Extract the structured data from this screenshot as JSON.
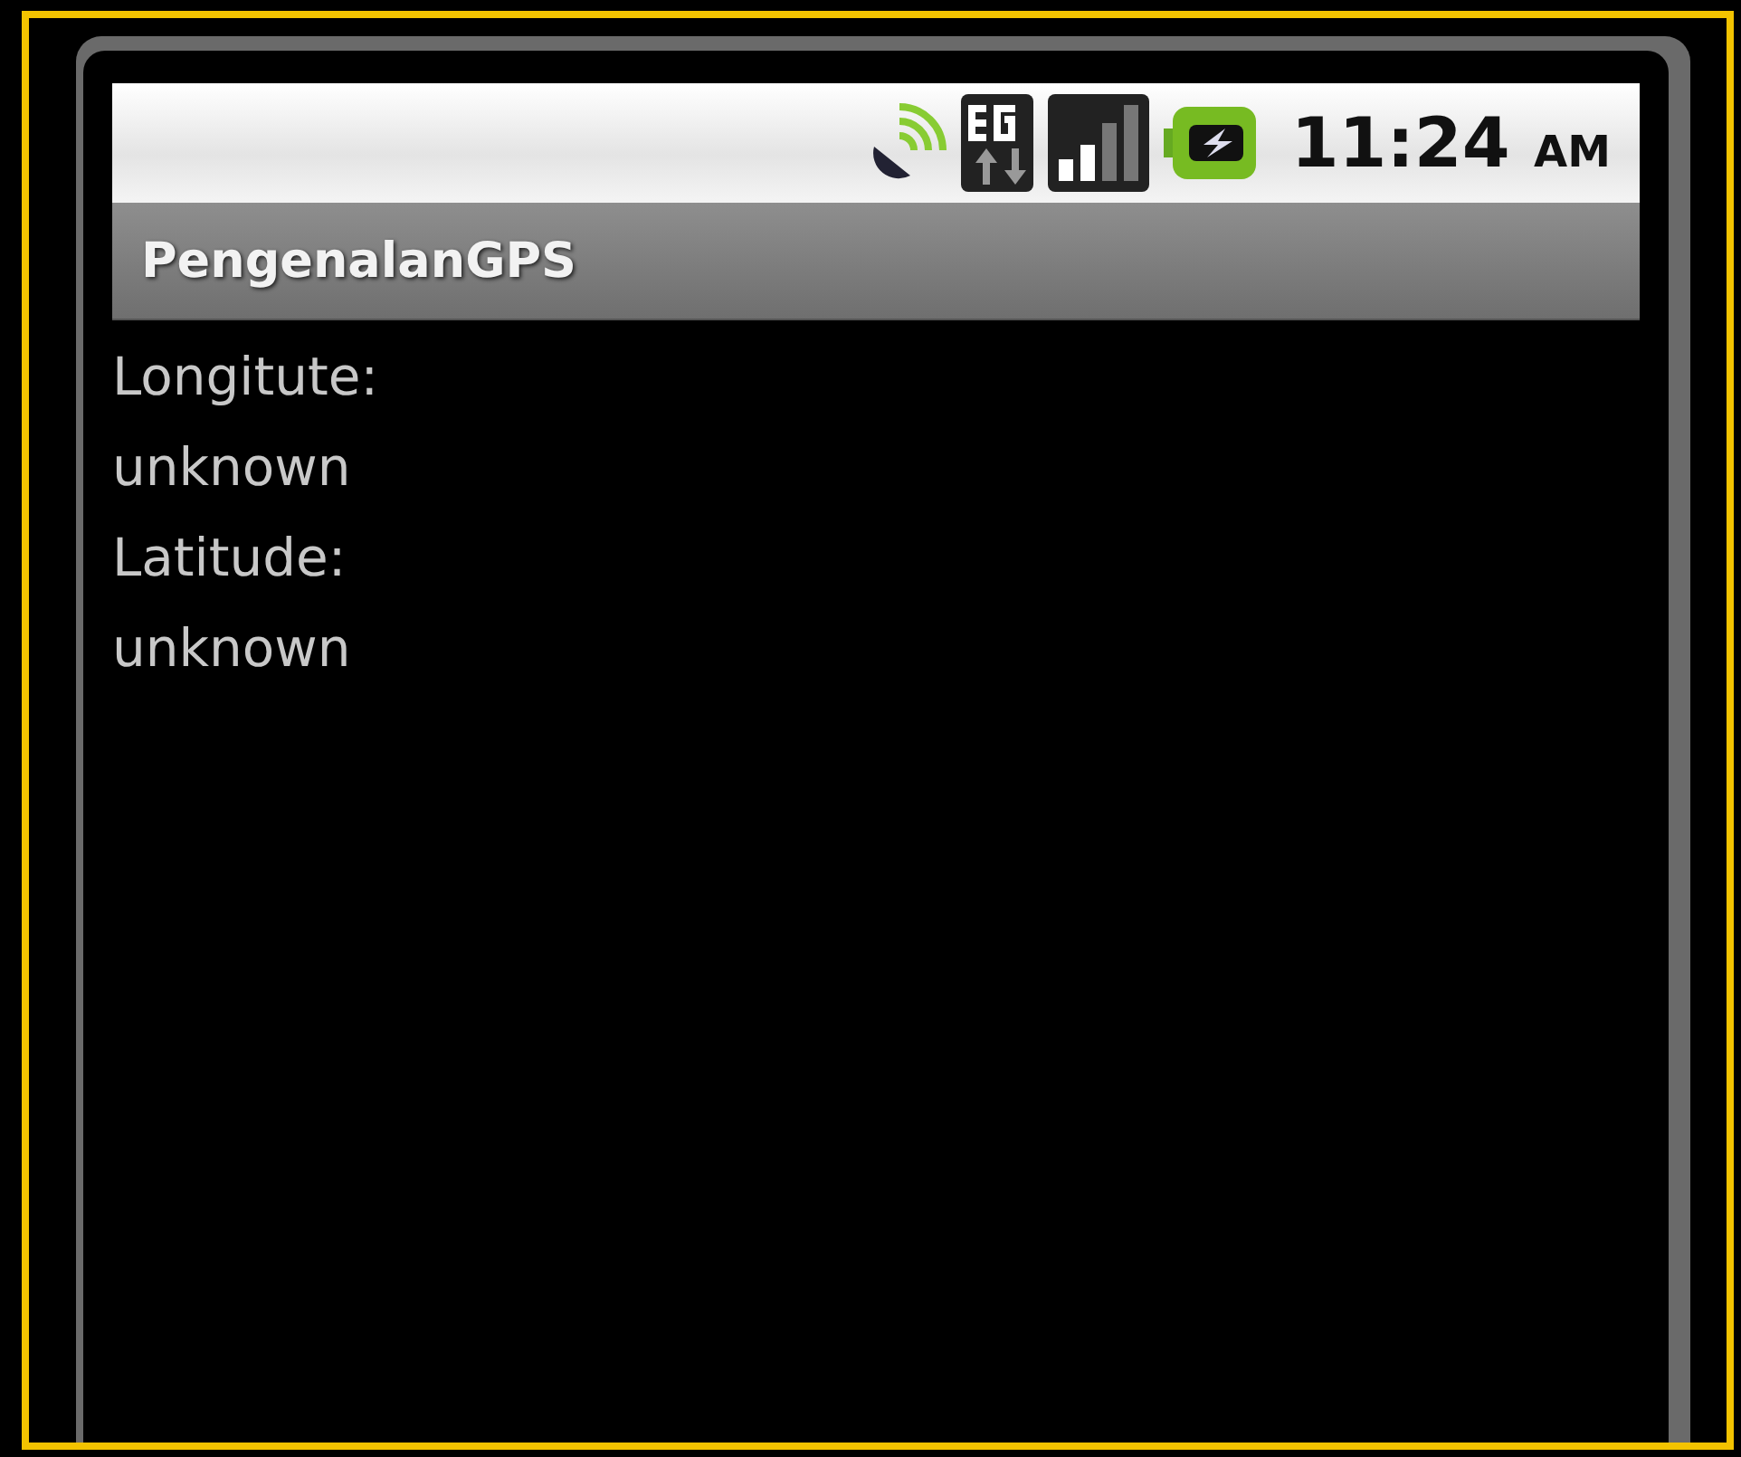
{
  "status_bar": {
    "time": "11:24",
    "meridiem": "AM"
  },
  "app_title": "PengenalanGPS",
  "lines": [
    "Longitute:",
    "unknown",
    "Latitude:",
    "unknown"
  ]
}
